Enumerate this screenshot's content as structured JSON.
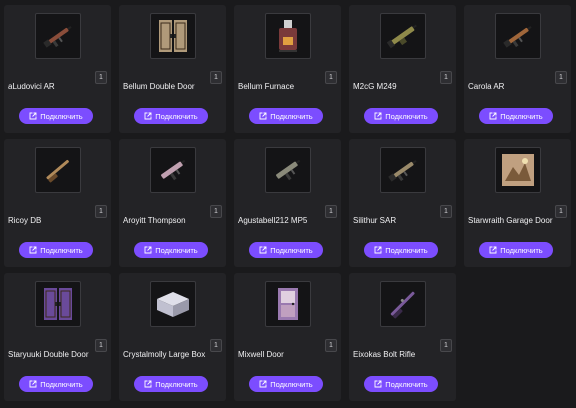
{
  "connect_label": "Подключить",
  "items": [
    {
      "name": "aLudovici AR",
      "qty": "1",
      "icon": "rifle-icon",
      "color": "#8a4d3a"
    },
    {
      "name": "Bellum Double Door",
      "qty": "1",
      "icon": "double-door-icon",
      "color": "#b09a7a"
    },
    {
      "name": "Bellum Furnace",
      "qty": "1",
      "icon": "furnace-icon",
      "color": "#7a3a3a"
    },
    {
      "name": "M2cG M249",
      "qty": "1",
      "icon": "machine-gun-icon",
      "color": "#8f8a4a"
    },
    {
      "name": "Carola AR",
      "qty": "1",
      "icon": "rifle-icon",
      "color": "#a0663a"
    },
    {
      "name": "Ricoy DB",
      "qty": "1",
      "icon": "shotgun-icon",
      "color": "#b08a5a"
    },
    {
      "name": "Aroyitt Thompson",
      "qty": "1",
      "icon": "smg-icon",
      "color": "#c0a0b0"
    },
    {
      "name": "Agustabell212 MP5",
      "qty": "1",
      "icon": "smg-icon",
      "color": "#8a8a7a"
    },
    {
      "name": "Silithur SAR",
      "qty": "1",
      "icon": "rifle-icon",
      "color": "#9a8a6a"
    },
    {
      "name": "Starwraith Garage Door",
      "qty": "1",
      "icon": "garage-door-icon",
      "color": "#c0a080"
    },
    {
      "name": "Staryuuki Double Door",
      "qty": "1",
      "icon": "double-door-icon",
      "color": "#6a4a9a"
    },
    {
      "name": "Crystalmolly Large Box",
      "qty": "1",
      "icon": "large-box-icon",
      "color": "#c0c0d0"
    },
    {
      "name": "Mixwell Door",
      "qty": "1",
      "icon": "door-icon",
      "color": "#9a7ab0"
    },
    {
      "name": "Eixokas Bolt Rifle",
      "qty": "1",
      "icon": "bolt-rifle-icon",
      "color": "#7a5a9a"
    }
  ]
}
